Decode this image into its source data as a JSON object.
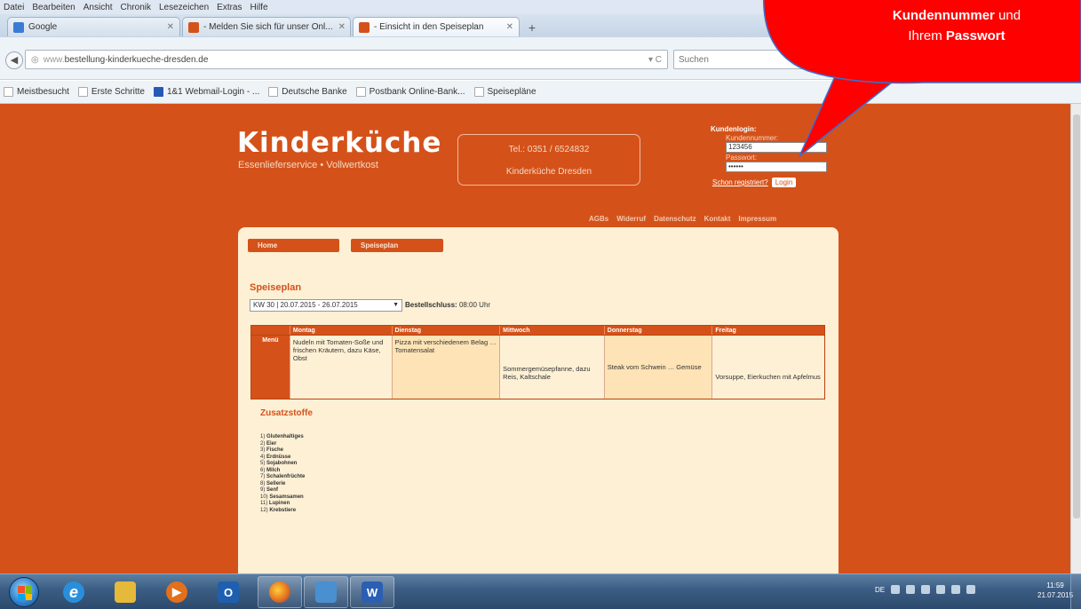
{
  "browser": {
    "menu": [
      "Datei",
      "Bearbeiten",
      "Ansicht",
      "Chronik",
      "Lesezeichen",
      "Extras",
      "Hilfe"
    ],
    "tabs": [
      {
        "label": "Google",
        "favicon_color": "#3a7bd5"
      },
      {
        "label": "- Melden Sie sich für unser Onl...",
        "favicon_color": "#d4521a"
      },
      {
        "label": "- Einsicht in den Speiseplan",
        "favicon_color": "#d4521a"
      }
    ],
    "new_tab": "+",
    "url_prefix": "www.",
    "url": "bestellung-kinderkueche-dresden.de",
    "url_controls": "▾ C",
    "search_placeholder": "Suchen",
    "bookmarks": [
      "Meistbesucht",
      "Erste Schritte",
      "1&1 Webmail-Login - ...",
      "Deutsche Banke",
      "Postbank Online-Bank...",
      "Speisepläne"
    ]
  },
  "site": {
    "logo": "Kinderküche",
    "tagline": "Essenlieferservice • Vollwertkost",
    "phone": "Tel.: 0351 / 6524832",
    "company": "Kinderküche Dresden",
    "login": {
      "title": "Kundenlogin:",
      "customer_label": "Kundennummer:",
      "customer_value": "123456",
      "password_label": "Passwort:",
      "password_value": "••••••",
      "registered_link": "Schon registriert?",
      "login_button": "Login"
    },
    "toplinks": [
      "AGBs",
      "Widerruf",
      "Datenschutz",
      "Kontakt",
      "Impressum"
    ],
    "nav": [
      "Home",
      "Speiseplan"
    ],
    "page_title": "Speiseplan",
    "week_select": "KW 30 | 20.07.2015 - 26.07.2015",
    "deadline_label": "Bestellschluss:",
    "deadline_value": "08:00 Uhr",
    "menu_table": {
      "row_label": "Menü",
      "days": [
        "Montag",
        "Dienstag",
        "Mittwoch",
        "Donnerstag",
        "Freitag"
      ],
      "dishes": [
        "Nudeln mit Tomaten-Soße und frischen Kräutern, dazu Käse, Obst",
        "Pizza mit verschiedenem Belag … Tomatensalat",
        "Sommergemüsepfanne, dazu Reis, Kaltschale",
        "Steak vom Schwein … Gemüse",
        "Vorsuppe, Eierkuchen mit Apfelmus"
      ]
    },
    "additives_title": "Zusatzstoffe",
    "additives": [
      {
        "n": "1)",
        "name": "Glutenhaltiges"
      },
      {
        "n": "2)",
        "name": "Eier"
      },
      {
        "n": "3)",
        "name": "Fische"
      },
      {
        "n": "4)",
        "name": "Erdnüsse"
      },
      {
        "n": "5)",
        "name": "Sojabohnen"
      },
      {
        "n": "6)",
        "name": "Milch"
      },
      {
        "n": "7)",
        "name": "Schalenfrüchte"
      },
      {
        "n": "8)",
        "name": "Sellerie"
      },
      {
        "n": "9)",
        "name": "Senf"
      },
      {
        "n": "10)",
        "name": "Sesamsamen"
      },
      {
        "n": "11)",
        "name": "Lupinen"
      },
      {
        "n": "12)",
        "name": "Krebstiere"
      }
    ]
  },
  "bubble": {
    "bold1": "Kundennummer",
    "text1": " und",
    "text2": "Ihrem ",
    "bold2": "Passwort"
  },
  "taskbar": {
    "apps": [
      {
        "name": "ie-icon",
        "color": "#2a8fdb",
        "label": "e"
      },
      {
        "name": "explorer-icon",
        "color": "#e5b93a",
        "label": ""
      },
      {
        "name": "media-player-icon",
        "color": "#e2701c",
        "label": "▶"
      },
      {
        "name": "outlook-icon",
        "color": "#1f5fb0",
        "label": "O"
      },
      {
        "name": "firefox-icon",
        "color": "#e36b1d",
        "label": ""
      },
      {
        "name": "shield-app-icon",
        "color": "#4a8fd0",
        "label": ""
      },
      {
        "name": "word-icon",
        "color": "#2b5fb3",
        "label": "W"
      }
    ],
    "lang": "DE",
    "time": "11:59",
    "date": "21.07.2015"
  },
  "colors": {
    "site_orange": "#d4521a",
    "panel_cream": "#fdf0d5",
    "bubble_red": "#ff0000"
  }
}
